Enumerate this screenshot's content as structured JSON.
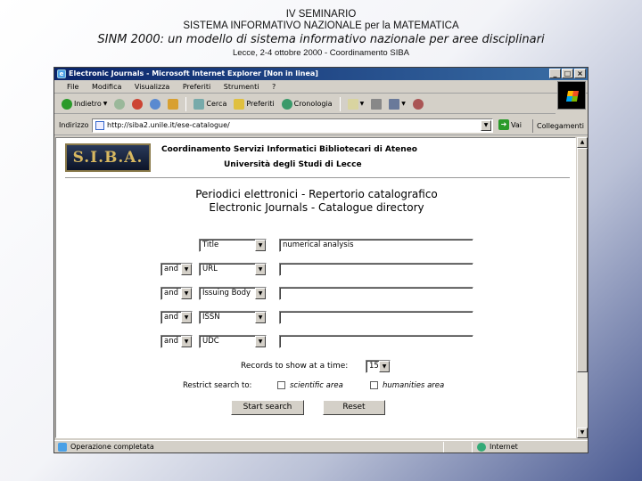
{
  "slide": {
    "line1": "IV SEMINARIO",
    "line2": "SISTEMA INFORMATIVO NAZIONALE per la MATEMATICA",
    "line3": "SINM 2000: un modello di sistema informativo nazionale per aree disciplinari",
    "line4": "Lecce, 2-4 ottobre 2000 - Coordinamento SIBA"
  },
  "browser": {
    "title": "Electronic Journals - Microsoft Internet Explorer [Non in linea]",
    "menus": [
      "File",
      "Modifica",
      "Visualizza",
      "Preferiti",
      "Strumenti",
      "?"
    ],
    "toolbar": {
      "back": "Indietro",
      "search": "Cerca",
      "favorites": "Preferiti",
      "history": "Cronologia"
    },
    "address_label": "Indirizzo",
    "address_value": "http://siba2.unile.it/ese-catalogue/",
    "go_label": "Vai",
    "links_label": "Collegamenti",
    "status_text": "Operazione completata",
    "zone_text": "Internet"
  },
  "page": {
    "logo_text": "S.I.B.A.",
    "org_line1": "Coordinamento Servizi Informatici Bibliotecari di Ateneo",
    "org_line2": "Università degli Studi di Lecce",
    "title1": "Periodici elettronici - Repertorio catalografico",
    "title2": "Electronic Journals - Catalogue directory",
    "rows": [
      {
        "operator": "",
        "field": "Title",
        "value": "numerical analysis"
      },
      {
        "operator": "and",
        "field": "URL",
        "value": ""
      },
      {
        "operator": "and",
        "field": "Issuing Body",
        "value": ""
      },
      {
        "operator": "and",
        "field": "ISSN",
        "value": ""
      },
      {
        "operator": "and",
        "field": "UDC",
        "value": ""
      }
    ],
    "records_label": "Records to show at a time:",
    "records_value": "15",
    "restrict_label": "Restrict search to:",
    "scientific_label": "scientific area",
    "humanities_label": "humanities area",
    "start_button": "Start search",
    "reset_button": "Reset"
  }
}
